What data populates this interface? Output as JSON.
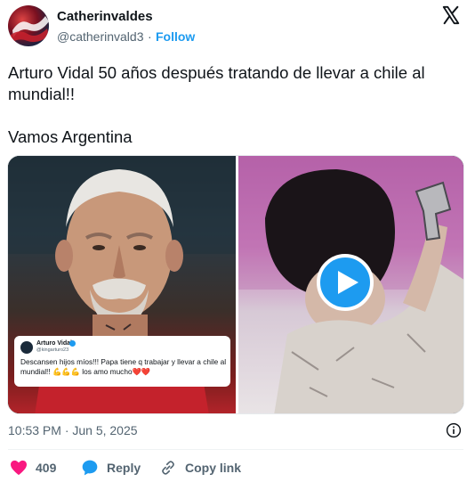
{
  "author": {
    "name": "Catherinvaldes",
    "handle": "@catherinvald3",
    "separator": "·",
    "follow_label": "Follow"
  },
  "tweet": {
    "line1": "Arturo Vidal 50 años después tratando de llevar a chile al mundial!!",
    "line2": "Vamos Argentina"
  },
  "media": {
    "embedded_post": {
      "name": "Arturo Vidal",
      "handle": "@kingarturo23",
      "text": "Descansen hijos míos!!! Papa tiene q trabajar y llevar a chile al mundial!!",
      "emoji": "💪💪💪",
      "text_end": "los amo mucho",
      "hearts": "❤️❤️"
    },
    "play_icon": "play-icon"
  },
  "timestamp": "10:53 PM · Jun 5, 2025",
  "actions": {
    "like_count": "409",
    "reply_label": "Reply",
    "copy_label": "Copy link"
  },
  "colors": {
    "accent": "#1d9bf0",
    "like": "#f91880",
    "muted": "#536471"
  },
  "icons": {
    "brand": "x-logo-icon",
    "info": "info-icon",
    "like": "heart-icon",
    "reply": "speech-bubble-icon",
    "copy": "link-icon"
  }
}
